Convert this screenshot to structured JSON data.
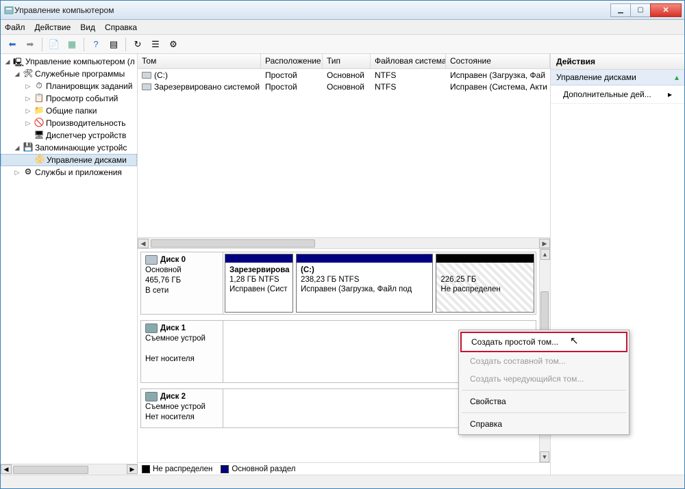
{
  "window": {
    "title": "Управление компьютером"
  },
  "menubar": {
    "file": "Файл",
    "action": "Действие",
    "view": "Вид",
    "help": "Справка"
  },
  "tree": {
    "root": "Управление компьютером (л",
    "sys_tools": "Служебные программы",
    "scheduler": "Планировщик заданий",
    "event_viewer": "Просмотр событий",
    "shared": "Общие папки",
    "perf": "Производительность",
    "devmgr": "Диспетчер устройств",
    "storage": "Запоминающие устройс",
    "diskmgmt": "Управление дисками",
    "services": "Службы и приложения"
  },
  "volumes": {
    "headers": {
      "volume": "Том",
      "layout": "Расположение",
      "type": "Тип",
      "fs": "Файловая система",
      "status": "Состояние"
    },
    "rows": [
      {
        "volume": "(C:)",
        "layout": "Простой",
        "type": "Основной",
        "fs": "NTFS",
        "status": "Исправен (Загрузка, Фай"
      },
      {
        "volume": "Зарезервировано системой",
        "layout": "Простой",
        "type": "Основной",
        "fs": "NTFS",
        "status": "Исправен (Система, Акти"
      }
    ]
  },
  "disks": {
    "disk0": {
      "name": "Диск 0",
      "type": "Основной",
      "size": "465,76 ГБ",
      "status": "В сети",
      "p1": {
        "title": "Зарезервирова",
        "size": "1,28 ГБ NTFS",
        "status": "Исправен (Сист"
      },
      "p2": {
        "title": "(C:)",
        "size": "238,23 ГБ NTFS",
        "status": "Исправен (Загрузка, Файл под"
      },
      "p3": {
        "size": "226,25 ГБ",
        "status": "Не распределен"
      }
    },
    "disk1": {
      "name": "Диск 1",
      "type": "Съемное устрой",
      "status": "Нет носителя"
    },
    "disk2": {
      "name": "Диск 2",
      "type": "Съемное устрой",
      "status": "Нет носителя"
    }
  },
  "legend": {
    "unalloc": "Не распределен",
    "primary": "Основной раздел"
  },
  "actions": {
    "header": "Действия",
    "section": "Управление дисками",
    "more": "Дополнительные дей..."
  },
  "context_menu": {
    "simple": "Создать простой том...",
    "spanned": "Создать составной том...",
    "striped": "Создать чередующийся том...",
    "props": "Свойства",
    "help": "Справка"
  }
}
